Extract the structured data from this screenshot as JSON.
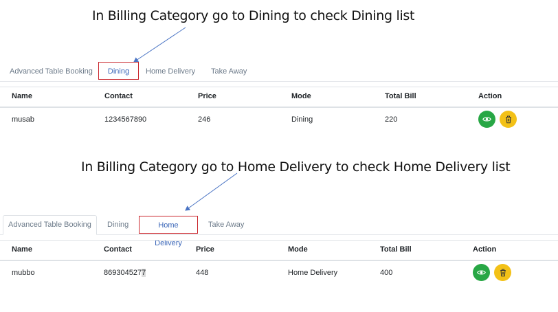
{
  "annotations": {
    "dining": "In Billing Category go to Dining to check Dining list",
    "home_delivery": "In Billing Category go to Home Delivery to check Home Delivery list"
  },
  "tabs": [
    "Advanced Table Booking",
    "Dining",
    "Home Delivery",
    "Take Away"
  ],
  "columns": [
    "Name",
    "Contact",
    "Price",
    "Mode",
    "Total Bill",
    "Action"
  ],
  "dining_row": {
    "name": "musab",
    "contact": "1234567890",
    "price": "246",
    "mode": "Dining",
    "total": "220"
  },
  "delivery_row": {
    "name": "mubbo",
    "contact_main": "869304527",
    "contact_last": "7",
    "price": "448",
    "mode": "Home Delivery",
    "total": "400"
  },
  "icons": {
    "view": "eye-icon",
    "delete": "trash-icon"
  },
  "colors": {
    "view": "#28a745",
    "delete": "#f3c117",
    "highlight_box": "#c9242b",
    "active_tab": "#3a66b8"
  }
}
